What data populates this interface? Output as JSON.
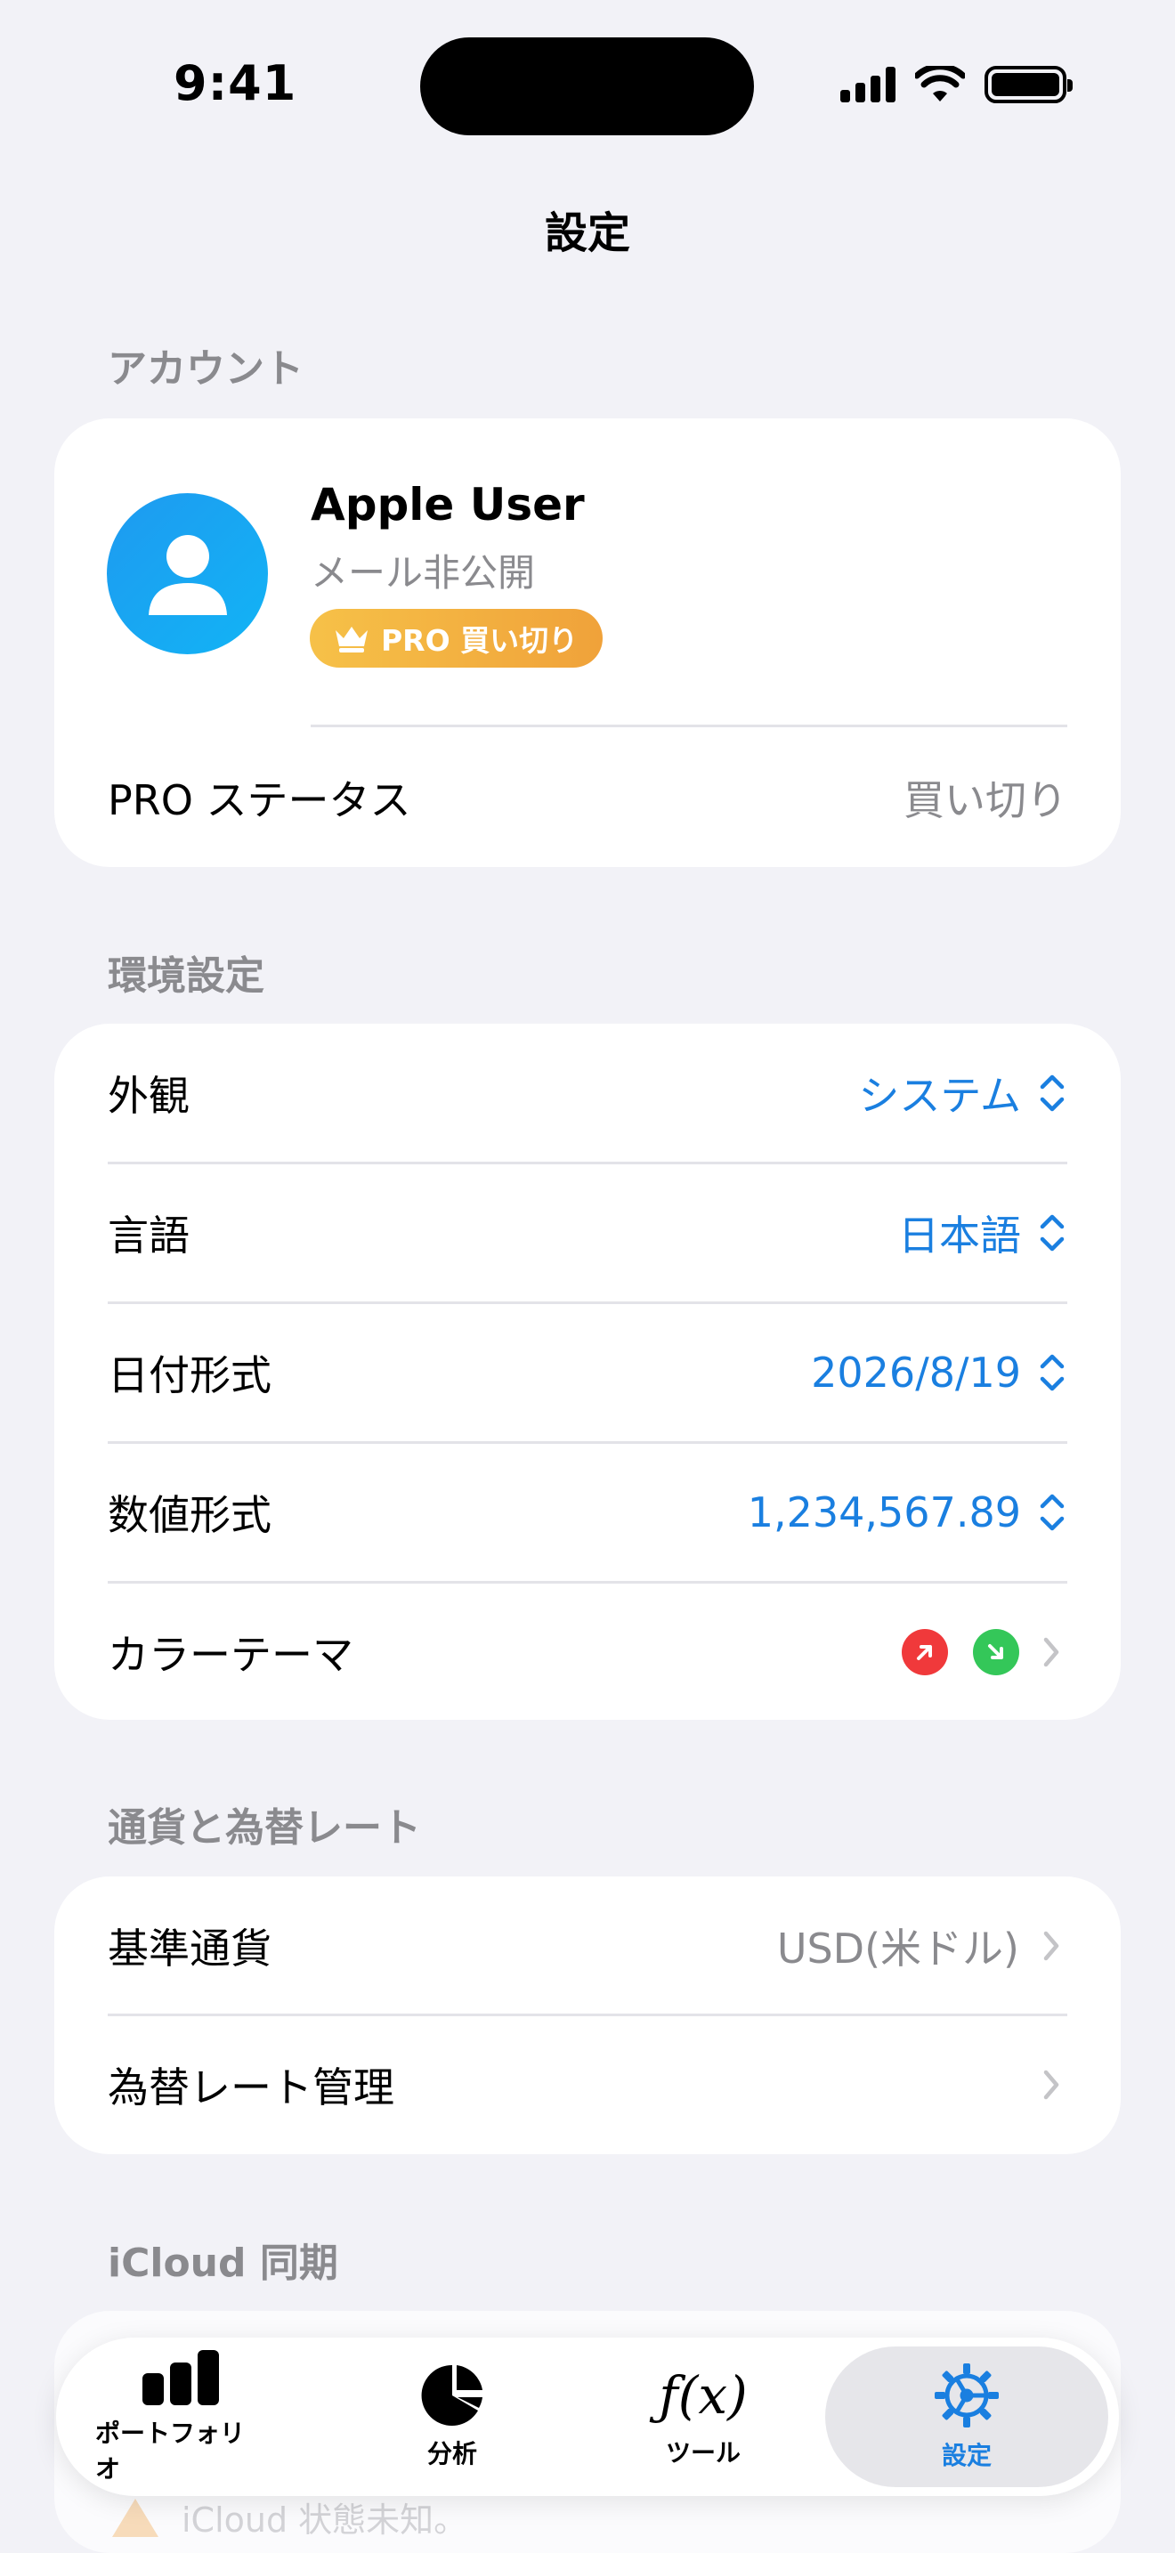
{
  "status_bar": {
    "time": "9:41"
  },
  "nav": {
    "title": "設定"
  },
  "account": {
    "header": "アカウント",
    "name": "Apple User",
    "email": "メール非公開",
    "badge": "PRO 買い切り",
    "pro_status_label": "PRO ステータス",
    "pro_status_value": "買い切り"
  },
  "preferences": {
    "header": "環境設定",
    "rows": [
      {
        "label": "外観",
        "value": "システム"
      },
      {
        "label": "言語",
        "value": "日本語"
      },
      {
        "label": "日付形式",
        "value": "2026/8/19"
      },
      {
        "label": "数値形式",
        "value": "1,234,567.89"
      },
      {
        "label": "カラーテーマ",
        "up_color": "#f0393b",
        "down_color": "#34c759"
      }
    ]
  },
  "currency": {
    "header": "通貨と為替レート",
    "rows": [
      {
        "label": "基準通貨",
        "value": "USD(米ドル)"
      },
      {
        "label": "為替レート管理"
      }
    ]
  },
  "icloud": {
    "header": "iCloud 同期",
    "peek_text": "iCloud 状態未知。"
  },
  "tabbar": {
    "tabs": [
      {
        "label": "ポートフォリオ",
        "icon": "bar-chart-icon"
      },
      {
        "label": "分析",
        "icon": "pie-chart-icon"
      },
      {
        "label": "ツール",
        "icon": "function-icon",
        "glyph": "ƒ(x)"
      },
      {
        "label": "設定",
        "icon": "gear-icon",
        "active": true
      }
    ]
  },
  "colors": {
    "accent": "#1a7fe0",
    "secondary_text": "#8a8a8e",
    "background": "#f2f2f7"
  }
}
